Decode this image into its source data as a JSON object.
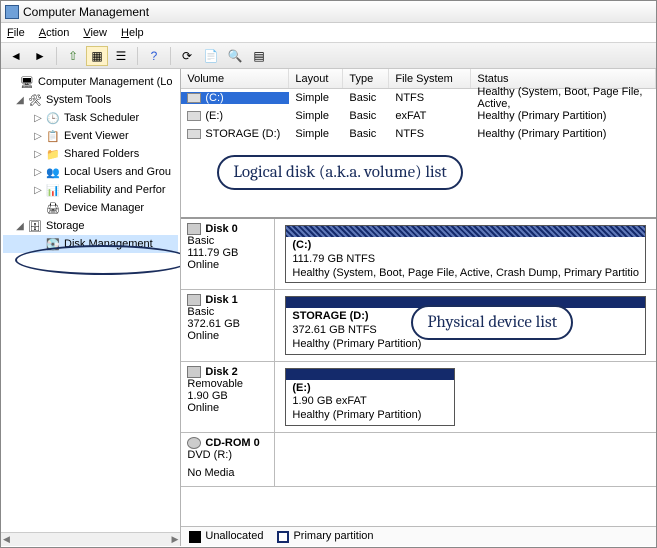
{
  "window": {
    "title": "Computer Management"
  },
  "menu": {
    "file": "File",
    "action": "Action",
    "view": "View",
    "help": "Help"
  },
  "tree": {
    "root": "Computer Management (Lo",
    "system_tools": "System Tools",
    "task_scheduler": "Task Scheduler",
    "event_viewer": "Event Viewer",
    "shared_folders": "Shared Folders",
    "local_users": "Local Users and Grou",
    "reliability": "Reliability and Perfor",
    "device_manager": "Device Manager",
    "storage": "Storage",
    "disk_management": "Disk Management"
  },
  "vol_head": {
    "volume": "Volume",
    "layout": "Layout",
    "type": "Type",
    "fs": "File System",
    "status": "Status"
  },
  "volumes": [
    {
      "name": "(C:)",
      "layout": "Simple",
      "type": "Basic",
      "fs": "NTFS",
      "status": "Healthy (System, Boot, Page File, Active,"
    },
    {
      "name": "(E:)",
      "layout": "Simple",
      "type": "Basic",
      "fs": "exFAT",
      "status": "Healthy (Primary Partition)"
    },
    {
      "name": "STORAGE (D:)",
      "layout": "Simple",
      "type": "Basic",
      "fs": "NTFS",
      "status": "Healthy (Primary Partition)"
    }
  ],
  "disks": [
    {
      "title": "Disk 0",
      "type": "Basic",
      "size": "111.79 GB",
      "state": "Online",
      "part": {
        "name": "(C:)",
        "size": "111.79 GB NTFS",
        "status": "Healthy (System, Boot, Page File, Active, Crash Dump, Primary Partitio"
      },
      "hatched": true
    },
    {
      "title": "Disk 1",
      "type": "Basic",
      "size": "372.61 GB",
      "state": "Online",
      "part": {
        "name": "STORAGE  (D:)",
        "size": "372.61 GB NTFS",
        "status": "Healthy (Primary Partition)"
      },
      "hatched": false
    },
    {
      "title": "Disk 2",
      "type": "Removable",
      "size": "1.90 GB",
      "state": "Online",
      "part": {
        "name": "(E:)",
        "size": "1.90 GB exFAT",
        "status": "Healthy (Primary Partition)"
      },
      "hatched": false
    }
  ],
  "cdrom": {
    "title": "CD-ROM 0",
    "sub": "DVD (R:)",
    "state": "No Media"
  },
  "legend": {
    "unallocated": "Unallocated",
    "primary": "Primary partition"
  },
  "annotations": {
    "volume_list": "Logical disk (a.k.a. volume) list",
    "device_list": "Physical device list"
  }
}
